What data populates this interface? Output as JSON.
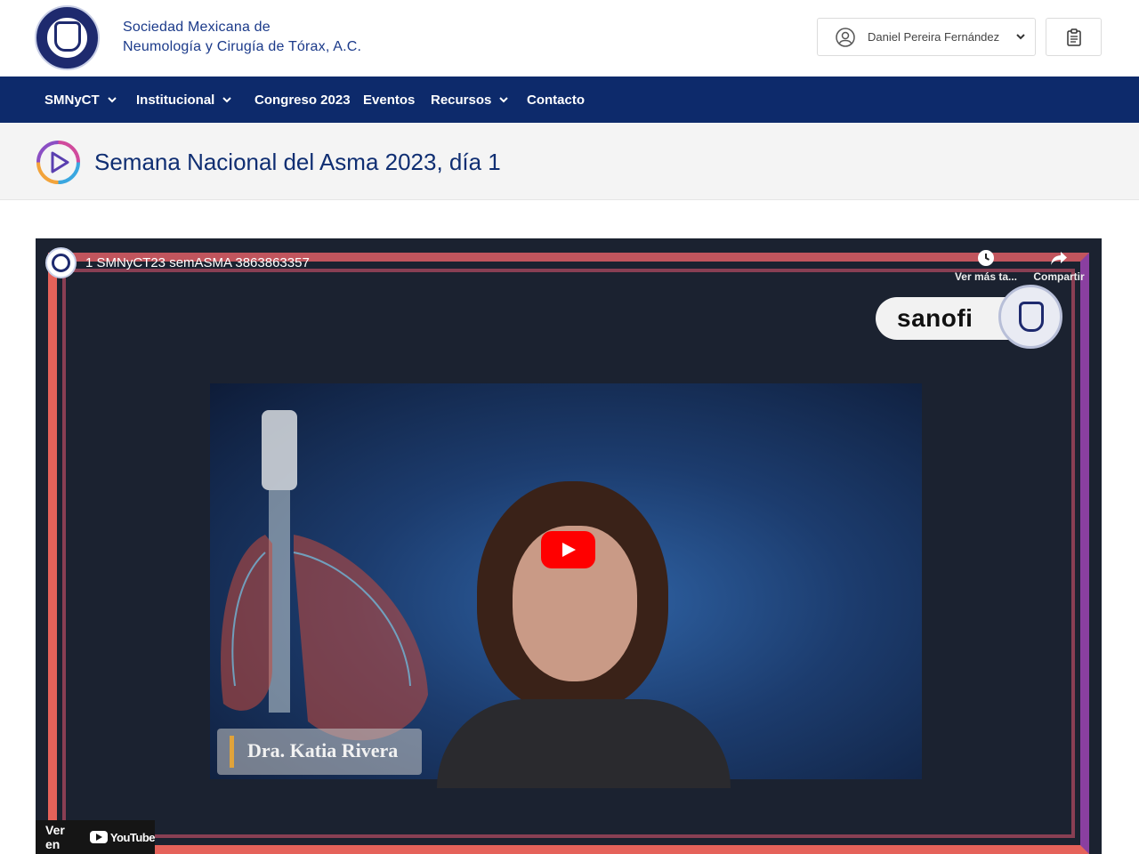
{
  "header": {
    "org_name_line1": "Sociedad Mexicana de",
    "org_name_line2": "Neumología y Cirugía de Tórax, A.C.",
    "user_name": "Daniel Pereira Fernández"
  },
  "nav": {
    "items": [
      {
        "label": "SMNyCT",
        "has_dropdown": true
      },
      {
        "label": "Institucional",
        "has_dropdown": true
      },
      {
        "label": "Congreso 2023",
        "has_dropdown": false
      },
      {
        "label": "Eventos",
        "has_dropdown": false
      },
      {
        "label": "Recursos",
        "has_dropdown": true
      },
      {
        "label": "Contacto",
        "has_dropdown": false
      }
    ]
  },
  "page": {
    "title": "Semana Nacional del Asma 2023, día 1"
  },
  "video": {
    "title": "1 SMNyCT23 semASMA 3863863357",
    "watch_later_label": "Ver más ta...",
    "share_label": "Compartir",
    "sponsor_name": "sanofi",
    "speaker_name": "Dra. Katia Rivera",
    "watch_on_label": "Ver en",
    "youtube_label": "YouTube"
  },
  "colors": {
    "nav_bg": "#0d2a6b",
    "brand_text": "#1b3a8a",
    "title_text": "#0f2e72",
    "youtube_red": "#ff0000"
  }
}
